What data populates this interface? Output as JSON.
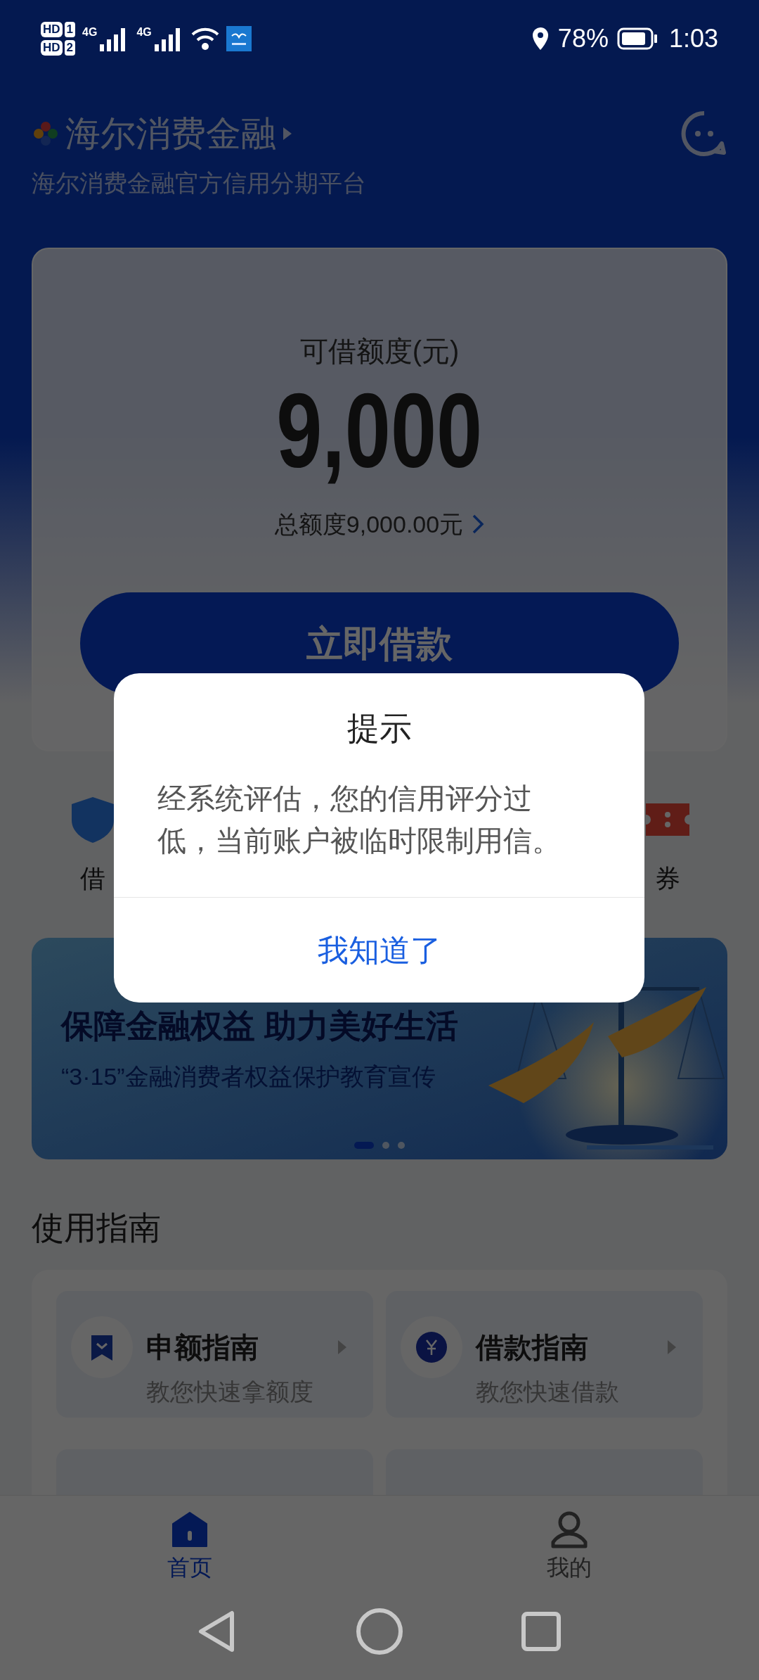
{
  "status_bar": {
    "sims": [
      {
        "label": "HD",
        "slot": "1"
      },
      {
        "label": "HD",
        "slot": "2"
      }
    ],
    "networks": [
      "4G",
      "4G"
    ],
    "battery_percent": "78%",
    "time": "1:03"
  },
  "header": {
    "logo": "海尔消费金融",
    "subtitle": "海尔消费金融官方信用分期平台"
  },
  "credit_card": {
    "label": "可借额度(元)",
    "amount": "9,000",
    "total": "总额度9,000.00元",
    "button": "立即借款"
  },
  "quick_actions": [
    {
      "kind": "shield",
      "label": "借"
    },
    {
      "kind": "ticket",
      "label": "券"
    }
  ],
  "banner": {
    "title": "保障金融权益 助力美好生活",
    "subtitle": "“3·15”金融消费者权益保护教育宣传",
    "dots": [
      {
        "selected": true
      },
      {
        "selected": false
      },
      {
        "selected": false
      }
    ]
  },
  "guide": {
    "title": "使用指南",
    "items": [
      {
        "kind": "bookmark",
        "title": "申额指南",
        "subtitle": "教您快速拿额度"
      },
      {
        "kind": "coin",
        "title": "借款指南",
        "subtitle": "教您快速借款"
      }
    ]
  },
  "tab_bar": [
    {
      "kind": "home",
      "label": "首页",
      "selected": true
    },
    {
      "kind": "me",
      "label": "我的",
      "selected": false
    }
  ],
  "dialog": {
    "title": "提示",
    "message": "经系统评估，您的信用评分过低，当前账户被临时限制用信。",
    "button": "我知道了"
  }
}
